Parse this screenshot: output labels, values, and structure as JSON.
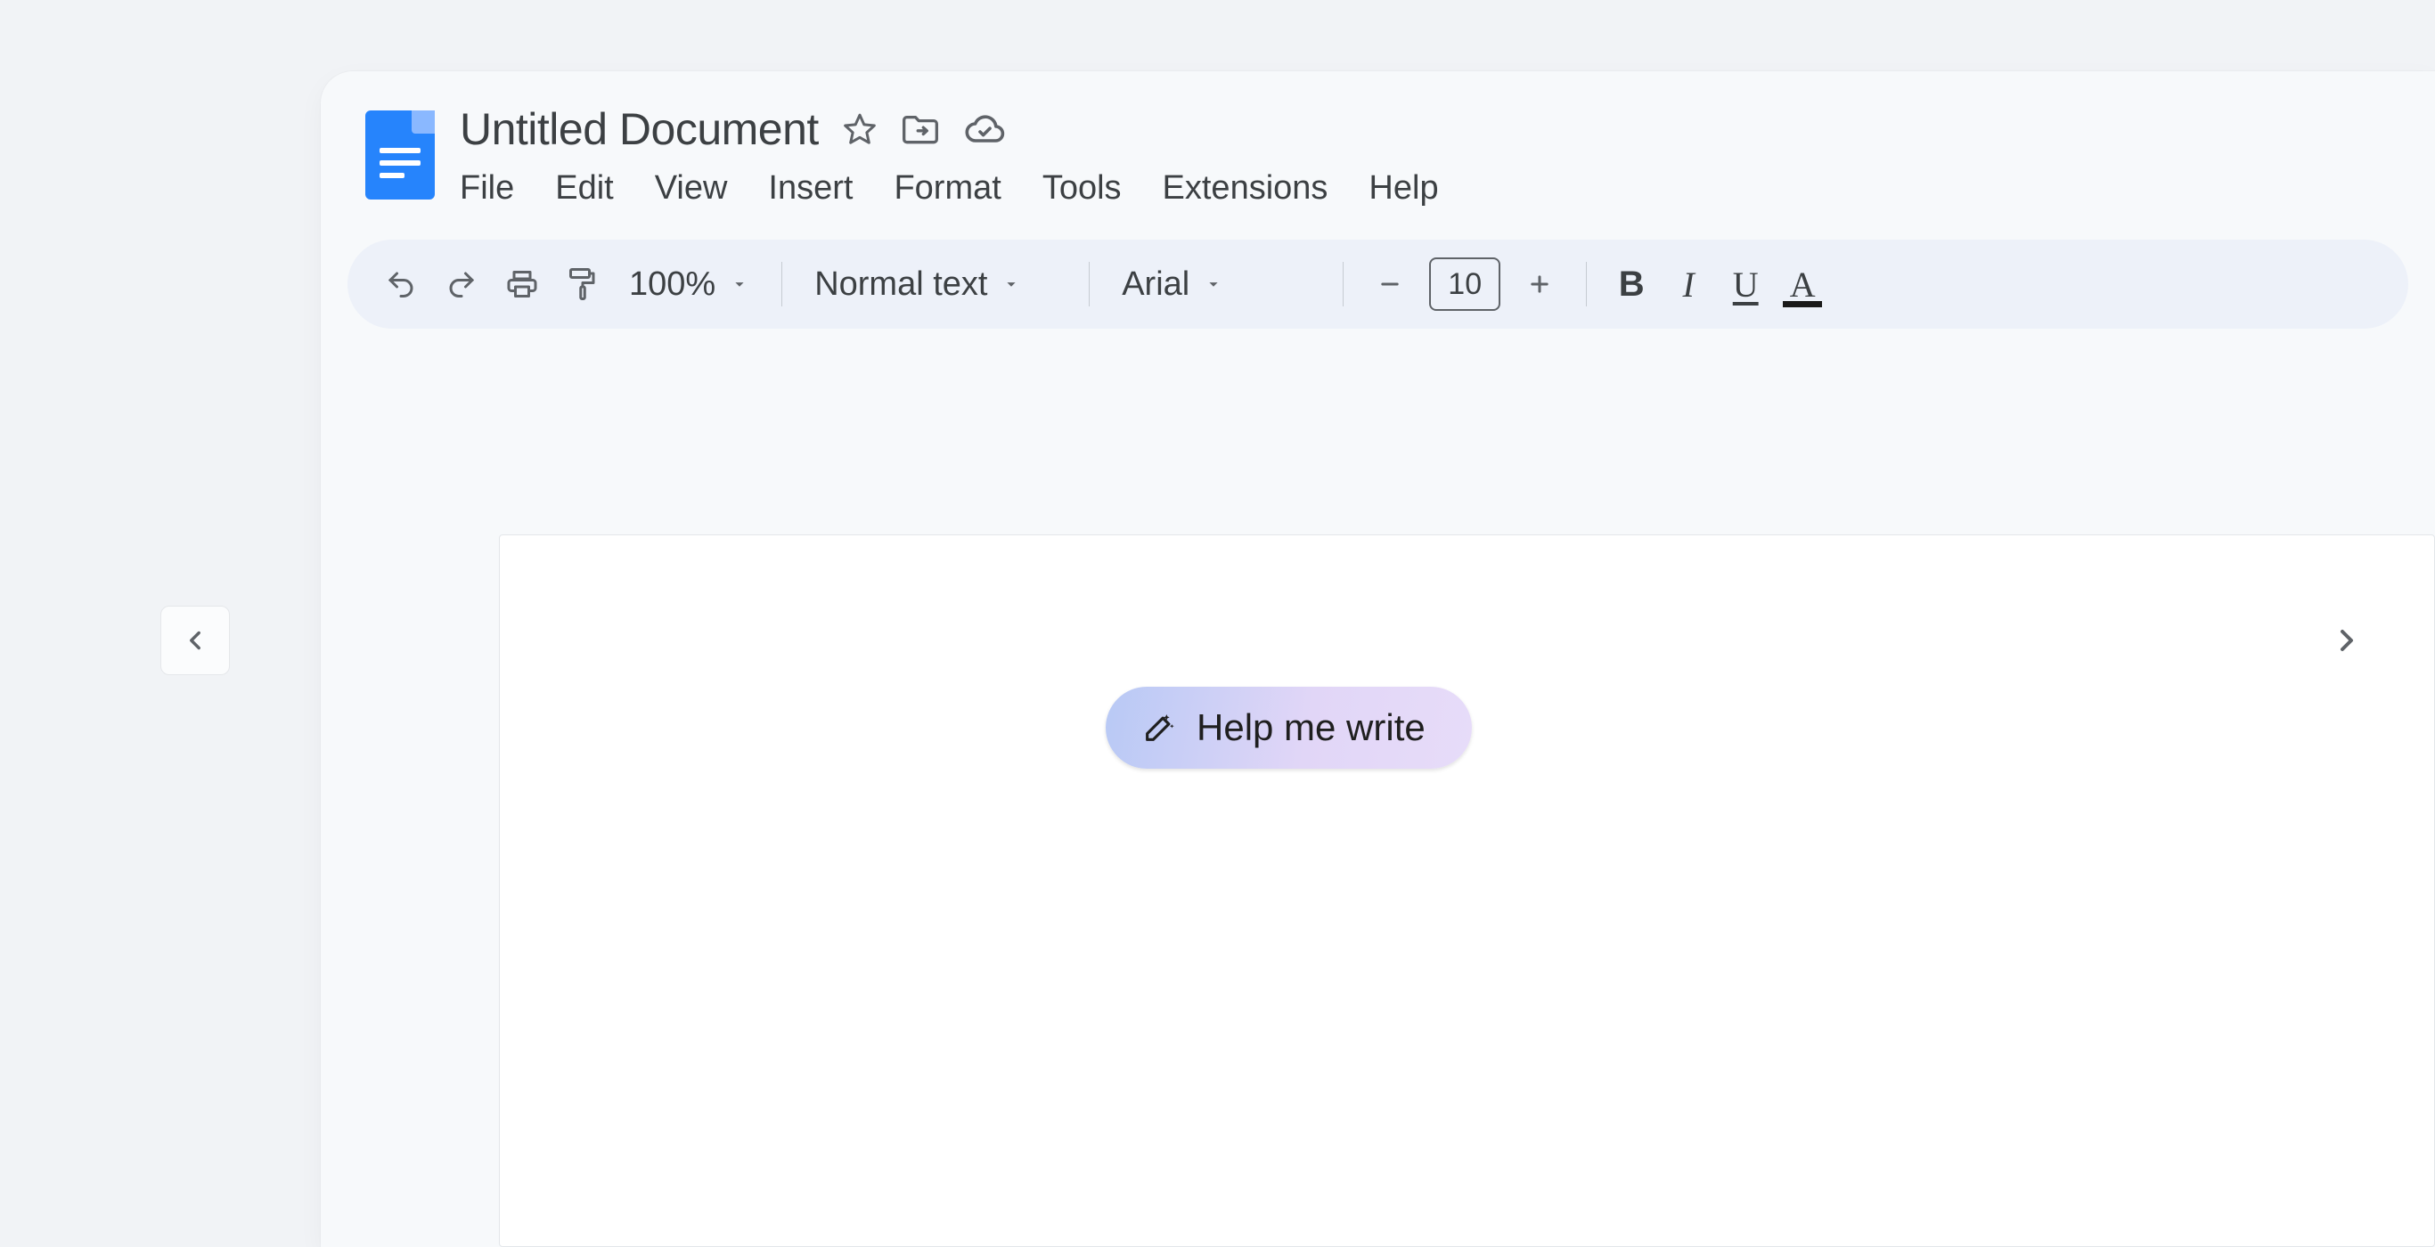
{
  "header": {
    "doc_title": "Untitled Document",
    "icons": {
      "star": "star-icon",
      "move": "move-to-folder-icon",
      "cloud": "cloud-saved-icon"
    }
  },
  "menubar": {
    "items": [
      "File",
      "Edit",
      "View",
      "Insert",
      "Format",
      "Tools",
      "Extensions",
      "Help"
    ]
  },
  "toolbar": {
    "zoom_label": "100%",
    "style_label": "Normal text",
    "font_label": "Arial",
    "font_size": "10"
  },
  "canvas": {
    "help_pill_label": "Help me write"
  }
}
